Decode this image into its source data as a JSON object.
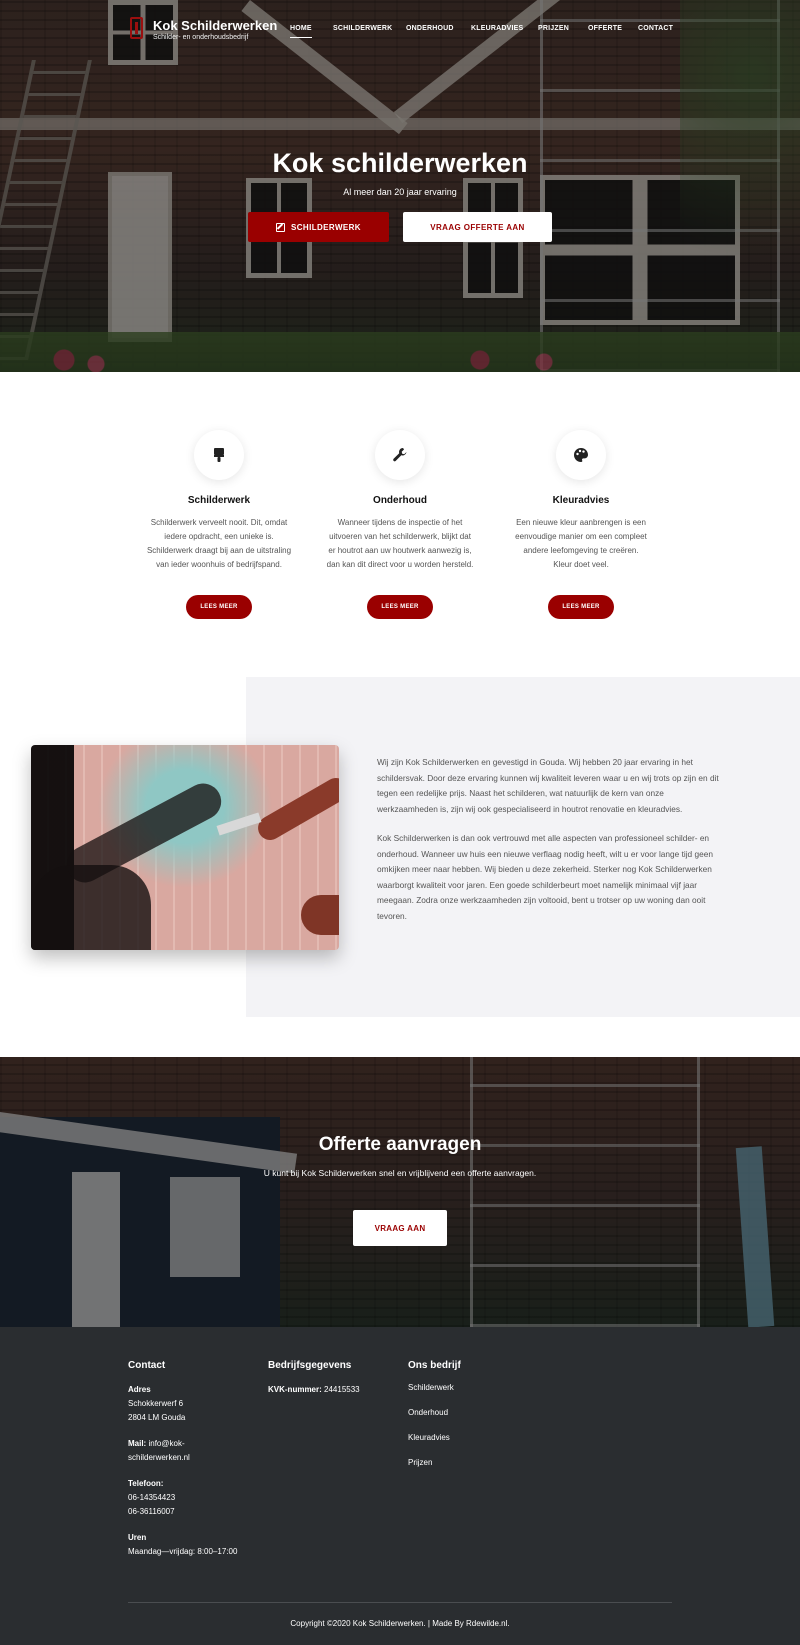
{
  "header": {
    "brand": "Kok Schilderwerken",
    "tagline": "Schilder- en onderhoudsbedrijf",
    "nav": [
      "HOME",
      "SCHILDERWERK",
      "ONDERHOUD",
      "KLEURADVIES",
      "PRIJZEN",
      "OFFERTE",
      "CONTACT"
    ],
    "active_nav": "HOME"
  },
  "hero": {
    "title": "Kok schilderwerken",
    "subtitle": "Al meer dan 20 jaar ervaring",
    "primary_button": "SCHILDERWERK",
    "secondary_button": "VRAAG OFFERTE AAN",
    "primary_icon": "edit-icon"
  },
  "services": [
    {
      "icon": "paint-brush-icon",
      "title": "Schilderwerk",
      "text": "Schilderwerk verveelt nooit. Dit, omdat iedere opdracht, een unieke is. Schilderwerk draagt bij aan de uitstraling van ieder woonhuis of bedrijfspand.",
      "button": "LEES MEER"
    },
    {
      "icon": "wrench-icon",
      "title": "Onderhoud",
      "text": "Wanneer tijdens de inspectie of het uitvoeren van het schilderwerk, blijkt dat er houtrot aan uw houtwerk aanwezig is, dan kan dit direct voor u worden hersteld.",
      "button": "LEES MEER"
    },
    {
      "icon": "palette-icon",
      "title": "Kleuradvies",
      "text": "Een nieuwe kleur aanbrengen is een eenvoudige manier om een compleet andere leefomgeving te creëren.\nKleur doet veel.",
      "button": "LEES MEER"
    }
  ],
  "about": {
    "paragraphs": [
      "Wij zijn Kok Schilderwerken en gevestigd in Gouda. Wij hebben 20 jaar ervaring in het schildersvak. Door deze ervaring kunnen wij kwaliteit leveren waar u en wij trots op zijn en dit tegen een redelijke prijs. Naast het schilderen, wat natuurlijk de kern van onze werkzaamheden is, zijn wij ook gespecialiseerd in houtrot renovatie en kleuradvies.",
      "Kok Schilderwerken is dan ook vertrouwd met alle aspecten van professioneel schilder- en onderhoud. Wanneer uw huis een nieuwe verflaag nodig heeft, wilt u er voor lange tijd geen omkijken meer naar hebben. Wij bieden u deze zekerheid. Sterker nog Kok Schilderwerken waarborgt kwaliteit voor jaren. Een goede schilderbeurt moet namelijk minimaal vijf jaar meegaan. Zodra onze werkzaamheden zijn voltooid, bent u trotser op uw woning dan ooit tevoren."
    ]
  },
  "cta": {
    "title": "Offerte aanvragen",
    "text": "U kunt bij Kok Schilderwerken snel en vrijblijvend een offerte aanvragen.",
    "button": "VRAAG AAN"
  },
  "footer": {
    "contact": {
      "heading": "Contact",
      "address_label": "Adres",
      "address_line1": "Schokkerwerf 6",
      "address_line2": "2804 LM Gouda",
      "mail_label": "Mail:",
      "mail_value_1": "info@kok-",
      "mail_value_2": "schilderwerken.nl",
      "phone_label": "Telefoon:",
      "phone_1": "06-14354423",
      "phone_2": "06-36116007",
      "hours_label": "Uren",
      "hours_value": "Maandag—vrijdag: 8:00–17:00"
    },
    "company": {
      "heading": "Bedrijfsgegevens",
      "kvk_label": "KVK-nummer:",
      "kvk_value": "24415533"
    },
    "about": {
      "heading": "Ons bedrijf",
      "links": [
        "Schilderwerk",
        "Onderhoud",
        "Kleuradvies",
        "Prijzen"
      ]
    },
    "copyright": "Copyright ©2020 Kok Schilderwerken. | Made By Rdewilde.nl."
  },
  "colors": {
    "accent": "#9a0000",
    "footer_bg": "#2a2d30",
    "about_bg": "#f3f3f6"
  }
}
